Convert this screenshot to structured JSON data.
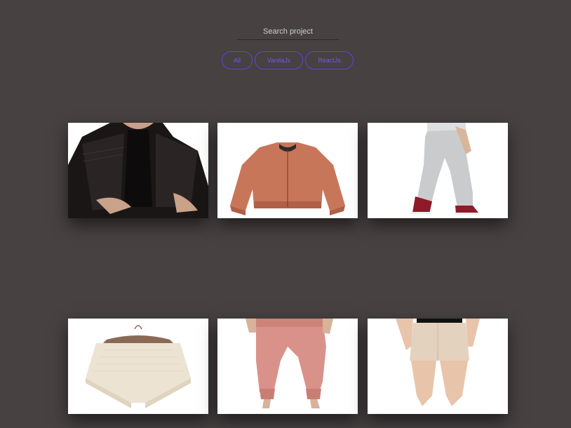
{
  "search": {
    "placeholder": "Search project"
  },
  "filters": [
    {
      "label": "All"
    },
    {
      "label": "VanilaJs"
    },
    {
      "label": "ReactJs"
    }
  ],
  "projects": [
    {
      "image": "black-leather-jacket"
    },
    {
      "image": "orange-bomber-jacket"
    },
    {
      "image": "grey-sweatpants-sneakers"
    },
    {
      "image": "cream-knit-poncho"
    },
    {
      "image": "pink-jogger-pants"
    },
    {
      "image": "beige-denim-skirt"
    }
  ],
  "colors": {
    "background": "#474142",
    "accent": "#5a46e0"
  }
}
